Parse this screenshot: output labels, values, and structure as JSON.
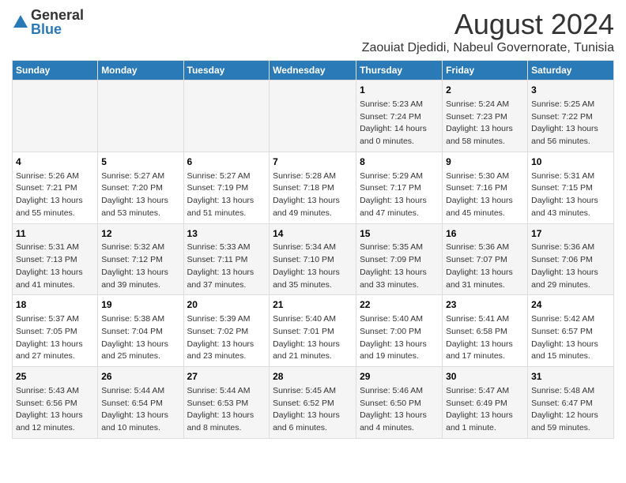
{
  "header": {
    "logo_general": "General",
    "logo_blue": "Blue",
    "title": "August 2024",
    "subtitle": "Zaouiat Djedidi, Nabeul Governorate, Tunisia"
  },
  "days_of_week": [
    "Sunday",
    "Monday",
    "Tuesday",
    "Wednesday",
    "Thursday",
    "Friday",
    "Saturday"
  ],
  "weeks": [
    [
      {
        "day": "",
        "content": ""
      },
      {
        "day": "",
        "content": ""
      },
      {
        "day": "",
        "content": ""
      },
      {
        "day": "",
        "content": ""
      },
      {
        "day": "1",
        "content": "Sunrise: 5:23 AM\nSunset: 7:24 PM\nDaylight: 14 hours and 0 minutes."
      },
      {
        "day": "2",
        "content": "Sunrise: 5:24 AM\nSunset: 7:23 PM\nDaylight: 13 hours and 58 minutes."
      },
      {
        "day": "3",
        "content": "Sunrise: 5:25 AM\nSunset: 7:22 PM\nDaylight: 13 hours and 56 minutes."
      }
    ],
    [
      {
        "day": "4",
        "content": "Sunrise: 5:26 AM\nSunset: 7:21 PM\nDaylight: 13 hours and 55 minutes."
      },
      {
        "day": "5",
        "content": "Sunrise: 5:27 AM\nSunset: 7:20 PM\nDaylight: 13 hours and 53 minutes."
      },
      {
        "day": "6",
        "content": "Sunrise: 5:27 AM\nSunset: 7:19 PM\nDaylight: 13 hours and 51 minutes."
      },
      {
        "day": "7",
        "content": "Sunrise: 5:28 AM\nSunset: 7:18 PM\nDaylight: 13 hours and 49 minutes."
      },
      {
        "day": "8",
        "content": "Sunrise: 5:29 AM\nSunset: 7:17 PM\nDaylight: 13 hours and 47 minutes."
      },
      {
        "day": "9",
        "content": "Sunrise: 5:30 AM\nSunset: 7:16 PM\nDaylight: 13 hours and 45 minutes."
      },
      {
        "day": "10",
        "content": "Sunrise: 5:31 AM\nSunset: 7:15 PM\nDaylight: 13 hours and 43 minutes."
      }
    ],
    [
      {
        "day": "11",
        "content": "Sunrise: 5:31 AM\nSunset: 7:13 PM\nDaylight: 13 hours and 41 minutes."
      },
      {
        "day": "12",
        "content": "Sunrise: 5:32 AM\nSunset: 7:12 PM\nDaylight: 13 hours and 39 minutes."
      },
      {
        "day": "13",
        "content": "Sunrise: 5:33 AM\nSunset: 7:11 PM\nDaylight: 13 hours and 37 minutes."
      },
      {
        "day": "14",
        "content": "Sunrise: 5:34 AM\nSunset: 7:10 PM\nDaylight: 13 hours and 35 minutes."
      },
      {
        "day": "15",
        "content": "Sunrise: 5:35 AM\nSunset: 7:09 PM\nDaylight: 13 hours and 33 minutes."
      },
      {
        "day": "16",
        "content": "Sunrise: 5:36 AM\nSunset: 7:07 PM\nDaylight: 13 hours and 31 minutes."
      },
      {
        "day": "17",
        "content": "Sunrise: 5:36 AM\nSunset: 7:06 PM\nDaylight: 13 hours and 29 minutes."
      }
    ],
    [
      {
        "day": "18",
        "content": "Sunrise: 5:37 AM\nSunset: 7:05 PM\nDaylight: 13 hours and 27 minutes."
      },
      {
        "day": "19",
        "content": "Sunrise: 5:38 AM\nSunset: 7:04 PM\nDaylight: 13 hours and 25 minutes."
      },
      {
        "day": "20",
        "content": "Sunrise: 5:39 AM\nSunset: 7:02 PM\nDaylight: 13 hours and 23 minutes."
      },
      {
        "day": "21",
        "content": "Sunrise: 5:40 AM\nSunset: 7:01 PM\nDaylight: 13 hours and 21 minutes."
      },
      {
        "day": "22",
        "content": "Sunrise: 5:40 AM\nSunset: 7:00 PM\nDaylight: 13 hours and 19 minutes."
      },
      {
        "day": "23",
        "content": "Sunrise: 5:41 AM\nSunset: 6:58 PM\nDaylight: 13 hours and 17 minutes."
      },
      {
        "day": "24",
        "content": "Sunrise: 5:42 AM\nSunset: 6:57 PM\nDaylight: 13 hours and 15 minutes."
      }
    ],
    [
      {
        "day": "25",
        "content": "Sunrise: 5:43 AM\nSunset: 6:56 PM\nDaylight: 13 hours and 12 minutes."
      },
      {
        "day": "26",
        "content": "Sunrise: 5:44 AM\nSunset: 6:54 PM\nDaylight: 13 hours and 10 minutes."
      },
      {
        "day": "27",
        "content": "Sunrise: 5:44 AM\nSunset: 6:53 PM\nDaylight: 13 hours and 8 minutes."
      },
      {
        "day": "28",
        "content": "Sunrise: 5:45 AM\nSunset: 6:52 PM\nDaylight: 13 hours and 6 minutes."
      },
      {
        "day": "29",
        "content": "Sunrise: 5:46 AM\nSunset: 6:50 PM\nDaylight: 13 hours and 4 minutes."
      },
      {
        "day": "30",
        "content": "Sunrise: 5:47 AM\nSunset: 6:49 PM\nDaylight: 13 hours and 1 minute."
      },
      {
        "day": "31",
        "content": "Sunrise: 5:48 AM\nSunset: 6:47 PM\nDaylight: 12 hours and 59 minutes."
      }
    ]
  ]
}
